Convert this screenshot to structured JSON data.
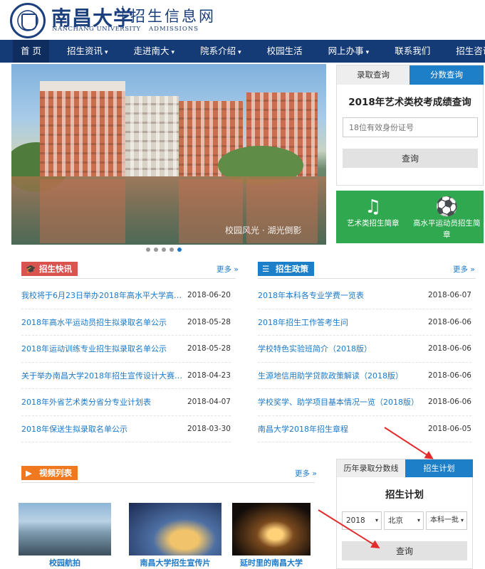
{
  "header": {
    "logo_cn": "南昌大学",
    "logo_en": "NANCHANG UNIVERSITY",
    "site_title": "招生信息网",
    "site_en": "ADMISSIONS"
  },
  "nav": [
    {
      "label": "首 页",
      "caret": ""
    },
    {
      "label": "招生资讯",
      "caret": "▾"
    },
    {
      "label": "走进南大",
      "caret": "▾"
    },
    {
      "label": "院系介绍",
      "caret": "▾"
    },
    {
      "label": "校园生活",
      "caret": ""
    },
    {
      "label": "网上办事",
      "caret": "▾"
    },
    {
      "label": "联系我们",
      "caret": ""
    },
    {
      "label": "招生咨询",
      "caret": "▾"
    }
  ],
  "slider": {
    "caption": "校园风光 · 湖光倒影"
  },
  "query": {
    "tab_admission": "录取查询",
    "tab_score": "分数查询",
    "title": "2018年艺术类校考成绩查询",
    "placeholder": "18位有效身份证号",
    "button": "查询"
  },
  "quick_links": {
    "art_label": "艺术类招生简章",
    "art_icon": "music-note-icon",
    "sport_label": "高水平运动员招生简章",
    "sport_icon": "soccer-ball-icon"
  },
  "news": {
    "title": "招生快讯",
    "more": "更多 »",
    "items": [
      {
        "title": "我校将于6月23日举办2018年高水平大学高招咨...",
        "date": "2018-06-20"
      },
      {
        "title": "2018年高水平运动员招生拟录取名单公示",
        "date": "2018-05-28"
      },
      {
        "title": "2018年运动训练专业招生拟录取名单公示",
        "date": "2018-05-28"
      },
      {
        "title": "关于举办南昌大学2018年招生宣传设计大赛的通知",
        "date": "2018-04-23"
      },
      {
        "title": "2018年外省艺术类分省分专业计划表",
        "date": "2018-04-07"
      },
      {
        "title": "2018年保送生拟录取名单公示",
        "date": "2018-03-30"
      }
    ]
  },
  "policy": {
    "title": "招生政策",
    "more": "更多 »",
    "items": [
      {
        "title": "2018年本科各专业学费一览表",
        "date": "2018-06-07"
      },
      {
        "title": "2018年招生工作答考生问",
        "date": "2018-06-06"
      },
      {
        "title": "学校特色实验班简介（2018版）",
        "date": "2018-06-06"
      },
      {
        "title": "生源地信用助学贷款政策解读（2018版）",
        "date": "2018-06-06"
      },
      {
        "title": "学校奖学、助学项目基本情况一览（2018版）",
        "date": "2018-06-06"
      },
      {
        "title": "南昌大学2018年招生章程",
        "date": "2018-06-05"
      }
    ]
  },
  "videos": {
    "title": "视频列表",
    "more": "更多 »",
    "items": [
      {
        "caption": "校园航拍"
      },
      {
        "caption": "南昌大学招生宣传片"
      },
      {
        "caption": "延时里的南昌大学"
      }
    ]
  },
  "plan": {
    "tab_history": "历年录取分数线",
    "tab_plan": "招生计划",
    "title": "招生计划",
    "year": "2018",
    "province": "北京",
    "batch": "本科一批",
    "button": "查询"
  },
  "colors": {
    "nav": "#153b77",
    "accent": "#1e7fc9",
    "green": "#2fa84f",
    "red_badge": "#d9534f",
    "orange_badge": "#f0791f",
    "arrow": "#e32b2b"
  }
}
